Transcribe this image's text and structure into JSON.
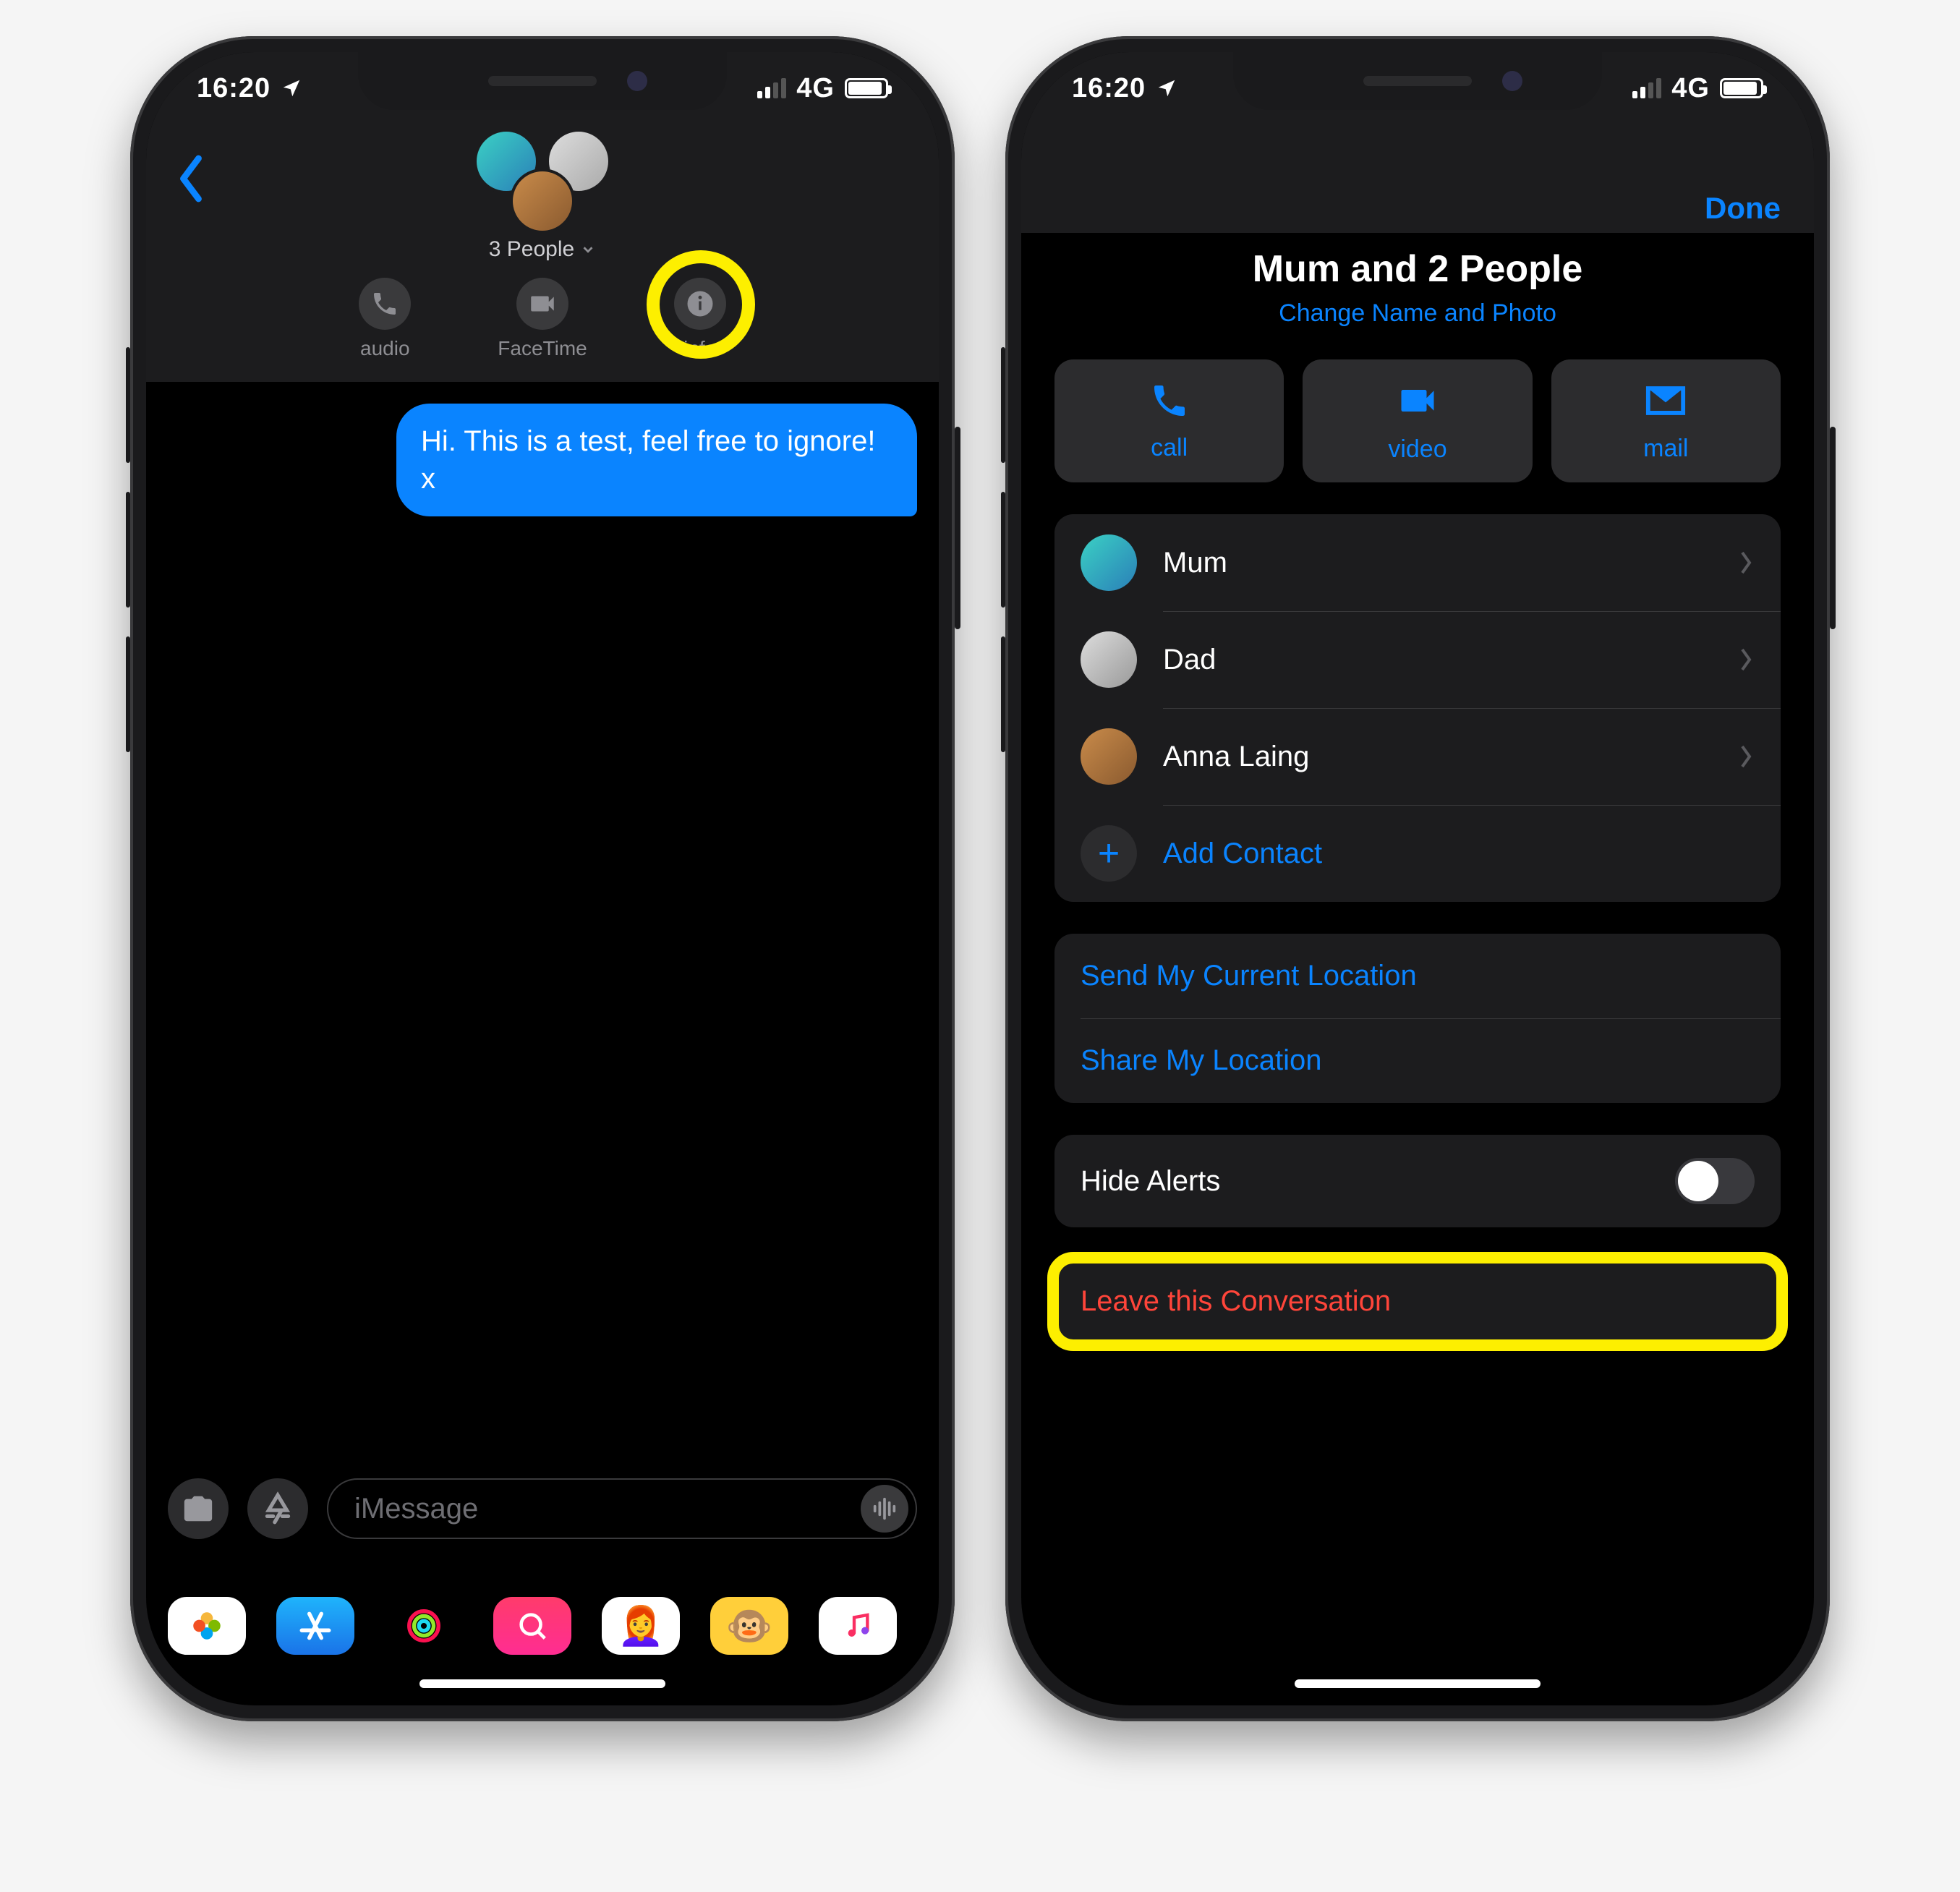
{
  "status": {
    "time": "16:20",
    "network": "4G"
  },
  "left": {
    "group_label": "3 People",
    "actions": {
      "audio": "audio",
      "facetime": "FaceTime",
      "info": "info"
    },
    "message": "Hi. This is a test, feel free to ignore! x",
    "input_placeholder": "iMessage"
  },
  "right": {
    "done": "Done",
    "title": "Mum and 2 People",
    "subtitle": "Change Name and Photo",
    "buttons": {
      "call": "call",
      "video": "video",
      "mail": "mail"
    },
    "members": [
      {
        "name": "Mum"
      },
      {
        "name": "Dad"
      },
      {
        "name": "Anna Laing"
      }
    ],
    "add_contact": "Add Contact",
    "send_location": "Send My Current Location",
    "share_location": "Share My Location",
    "hide_alerts": "Hide Alerts",
    "leave": "Leave this Conversation"
  }
}
